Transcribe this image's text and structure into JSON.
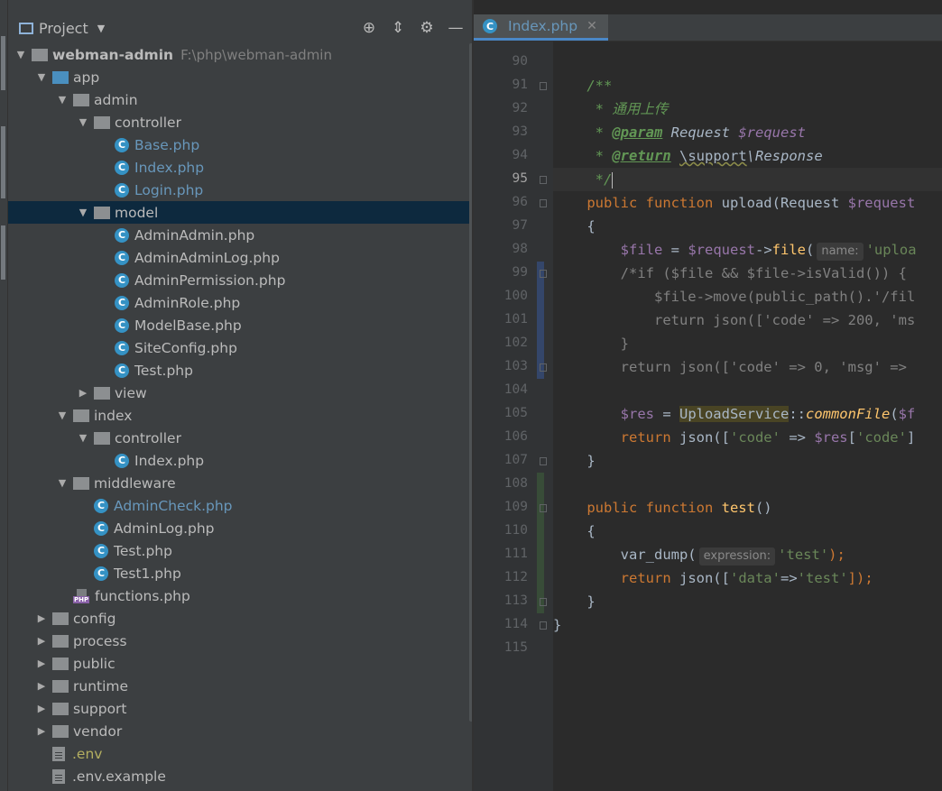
{
  "project_panel": {
    "title": "Project",
    "actions": [
      "locate-icon",
      "collapse-all-icon",
      "gear-icon",
      "hide-icon"
    ]
  },
  "tree": [
    {
      "label": "webman-admin",
      "path": "F:\\php\\webman-admin",
      "indent": 0,
      "arrow": "down",
      "icon": "folder-grey",
      "style": "bold"
    },
    {
      "label": "app",
      "indent": 1,
      "arrow": "down",
      "icon": "folder-blue"
    },
    {
      "label": "admin",
      "indent": 2,
      "arrow": "down",
      "icon": "folder-grey"
    },
    {
      "label": "controller",
      "indent": 3,
      "arrow": "down",
      "icon": "folder-grey"
    },
    {
      "label": "Base.php",
      "indent": 4,
      "icon": "class",
      "style": "blue"
    },
    {
      "label": "Index.php",
      "indent": 4,
      "icon": "class",
      "style": "blue"
    },
    {
      "label": "Login.php",
      "indent": 4,
      "icon": "class",
      "style": "blue"
    },
    {
      "label": "model",
      "indent": 3,
      "arrow": "down",
      "icon": "folder-grey",
      "selected": true
    },
    {
      "label": "AdminAdmin.php",
      "indent": 4,
      "icon": "class"
    },
    {
      "label": "AdminAdminLog.php",
      "indent": 4,
      "icon": "class"
    },
    {
      "label": "AdminPermission.php",
      "indent": 4,
      "icon": "class"
    },
    {
      "label": "AdminRole.php",
      "indent": 4,
      "icon": "class"
    },
    {
      "label": "ModelBase.php",
      "indent": 4,
      "icon": "class"
    },
    {
      "label": "SiteConfig.php",
      "indent": 4,
      "icon": "class"
    },
    {
      "label": "Test.php",
      "indent": 4,
      "icon": "class"
    },
    {
      "label": "view",
      "indent": 3,
      "arrow": "right",
      "icon": "folder-grey"
    },
    {
      "label": "index",
      "indent": 2,
      "arrow": "down",
      "icon": "folder-grey"
    },
    {
      "label": "controller",
      "indent": 3,
      "arrow": "down",
      "icon": "folder-grey"
    },
    {
      "label": "Index.php",
      "indent": 4,
      "icon": "class"
    },
    {
      "label": "middleware",
      "indent": 2,
      "arrow": "down",
      "icon": "folder-grey"
    },
    {
      "label": "AdminCheck.php",
      "indent": 3,
      "icon": "class",
      "style": "blue"
    },
    {
      "label": "AdminLog.php",
      "indent": 3,
      "icon": "class"
    },
    {
      "label": "Test.php",
      "indent": 3,
      "icon": "class"
    },
    {
      "label": "Test1.php",
      "indent": 3,
      "icon": "class"
    },
    {
      "label": "functions.php",
      "indent": 2,
      "icon": "php"
    },
    {
      "label": "config",
      "indent": 1,
      "arrow": "right",
      "icon": "folder-grey"
    },
    {
      "label": "process",
      "indent": 1,
      "arrow": "right",
      "icon": "folder-grey"
    },
    {
      "label": "public",
      "indent": 1,
      "arrow": "right",
      "icon": "folder-grey"
    },
    {
      "label": "runtime",
      "indent": 1,
      "arrow": "right",
      "icon": "folder-grey"
    },
    {
      "label": "support",
      "indent": 1,
      "arrow": "right",
      "icon": "folder-grey"
    },
    {
      "label": "vendor",
      "indent": 1,
      "arrow": "right",
      "icon": "folder-grey"
    },
    {
      "label": ".env",
      "indent": 1,
      "icon": "file",
      "style": "yellow"
    },
    {
      "label": ".env.example",
      "indent": 1,
      "icon": "file"
    }
  ],
  "editor": {
    "tab": {
      "label": "Index.php",
      "icon": "class-icon"
    },
    "current_line": 95,
    "lines": [
      {
        "n": 90,
        "t": [
          [
            "",
            ""
          ]
        ]
      },
      {
        "n": 91,
        "t": [
          [
            "    ",
            ""
          ],
          [
            "/**",
            "dc"
          ]
        ]
      },
      {
        "n": 92,
        "t": [
          [
            "     ",
            ""
          ],
          [
            "* 通用上传",
            "dc"
          ]
        ]
      },
      {
        "n": 93,
        "t": [
          [
            "     ",
            ""
          ],
          [
            "* ",
            "dc"
          ],
          [
            "@param",
            "dt"
          ],
          [
            " Request ",
            "dc-plain"
          ],
          [
            "$request",
            "vr-it"
          ]
        ]
      },
      {
        "n": 94,
        "t": [
          [
            "     ",
            ""
          ],
          [
            "* ",
            "dc"
          ],
          [
            "@return",
            "dt"
          ],
          [
            " ",
            "dc"
          ],
          [
            "\\support",
            "squig"
          ],
          [
            "\\Response",
            "dc-plain"
          ]
        ]
      },
      {
        "n": 95,
        "t": [
          [
            "     ",
            ""
          ],
          [
            "*/",
            "dc"
          ],
          [
            "|",
            "caret"
          ]
        ]
      },
      {
        "n": 96,
        "t": [
          [
            "    ",
            ""
          ],
          [
            "public function ",
            "kw"
          ],
          [
            "upload",
            ""
          ],
          [
            "(Request ",
            ""
          ],
          [
            "$request",
            "vr"
          ]
        ]
      },
      {
        "n": 97,
        "t": [
          [
            "    {",
            ""
          ]
        ]
      },
      {
        "n": 98,
        "t": [
          [
            "        ",
            ""
          ],
          [
            "$file",
            "vr"
          ],
          [
            " = ",
            ""
          ],
          [
            "$request",
            "vr"
          ],
          [
            "->",
            ""
          ],
          [
            "file",
            "fn"
          ],
          [
            "(",
            ""
          ],
          [
            "name:",
            "hint"
          ],
          [
            "'uploa",
            "st"
          ]
        ]
      },
      {
        "n": 99,
        "t": [
          [
            "        ",
            ""
          ],
          [
            "/*if ($file && $file->isValid()) {",
            "cm"
          ]
        ]
      },
      {
        "n": 100,
        "t": [
          [
            "            ",
            ""
          ],
          [
            "$file->move(public_path().'/fil",
            "cm"
          ]
        ]
      },
      {
        "n": 101,
        "t": [
          [
            "            ",
            ""
          ],
          [
            "return json(['code' => 200, 'ms",
            "cm"
          ]
        ]
      },
      {
        "n": 102,
        "t": [
          [
            "        ",
            ""
          ],
          [
            "}",
            "cm"
          ]
        ]
      },
      {
        "n": 103,
        "t": [
          [
            "        ",
            ""
          ],
          [
            "return json(['code' => 0, 'msg' =>",
            "cm"
          ]
        ]
      },
      {
        "n": 104,
        "t": [
          [
            "",
            ""
          ]
        ]
      },
      {
        "n": 105,
        "t": [
          [
            "        ",
            ""
          ],
          [
            "$res",
            "vr"
          ],
          [
            " = ",
            ""
          ],
          [
            "UploadService",
            "hl"
          ],
          [
            "::",
            ""
          ],
          [
            "commonFile",
            "it"
          ],
          [
            "(",
            ""
          ],
          [
            "$f",
            "vr"
          ]
        ]
      },
      {
        "n": 106,
        "t": [
          [
            "        ",
            ""
          ],
          [
            "return ",
            "kw"
          ],
          [
            "json([",
            ""
          ],
          [
            "'code'",
            "st"
          ],
          [
            " => ",
            ""
          ],
          [
            "$res",
            "vr"
          ],
          [
            "[",
            ""
          ],
          [
            "'code'",
            "st"
          ],
          [
            "]",
            ""
          ]
        ]
      },
      {
        "n": 107,
        "t": [
          [
            "    }",
            ""
          ]
        ]
      },
      {
        "n": 108,
        "t": [
          [
            "",
            ""
          ]
        ]
      },
      {
        "n": 109,
        "t": [
          [
            "    ",
            ""
          ],
          [
            "public function ",
            "kw"
          ],
          [
            "test",
            "fn"
          ],
          [
            "()",
            ""
          ]
        ]
      },
      {
        "n": 110,
        "t": [
          [
            "    {",
            ""
          ]
        ]
      },
      {
        "n": 111,
        "t": [
          [
            "        ",
            ""
          ],
          [
            "var_dump(",
            ""
          ],
          [
            "expression:",
            "hint"
          ],
          [
            "'test'",
            "st"
          ],
          [
            ");",
            "kw"
          ]
        ]
      },
      {
        "n": 112,
        "t": [
          [
            "        ",
            ""
          ],
          [
            "return ",
            "kw"
          ],
          [
            "json([",
            ""
          ],
          [
            "'data'",
            "st"
          ],
          [
            "=>",
            ""
          ],
          [
            "'test'",
            "st"
          ],
          [
            "]);",
            "kw"
          ]
        ]
      },
      {
        "n": 113,
        "t": [
          [
            "    }",
            ""
          ]
        ]
      },
      {
        "n": 114,
        "t": [
          [
            "}",
            ""
          ]
        ]
      },
      {
        "n": 115,
        "t": [
          [
            "",
            ""
          ]
        ]
      }
    ]
  }
}
